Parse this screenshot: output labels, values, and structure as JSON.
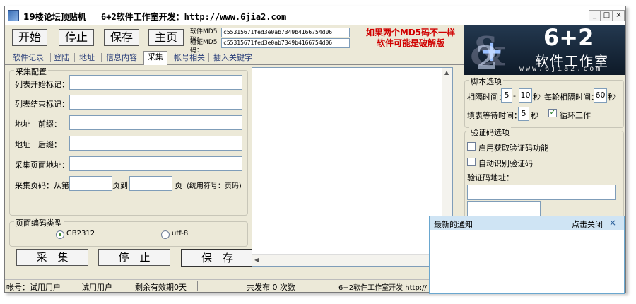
{
  "titlebar": {
    "title": "19楼论坛顶贴机",
    "subtitle": "6+2软件工作室开发：http://www.6jia2.com",
    "controls": {
      "minimize": "_",
      "maximize": "□",
      "close": "×"
    }
  },
  "toolbar": {
    "start": "开始",
    "stop": "停止",
    "save": "保存",
    "home": "主页"
  },
  "md5": {
    "software_label": "软件MD5码：",
    "software_value": "c55315671fed3e0ab7349b4166754d06",
    "verify_label": "验证MD5码：",
    "verify_value": "c55315671fed3e0ab7349b4166754d06"
  },
  "warning": {
    "line1": "如果两个MD5码不一样",
    "line2": "软件可能是破解版"
  },
  "logo": {
    "brand": "6+2",
    "studio": "软件工作室",
    "url": "www.6jia2.com"
  },
  "tabs": [
    "软件记录",
    "登陆",
    "地址",
    "信息内容",
    "采集",
    "帐号相关",
    "插入关键字"
  ],
  "collect": {
    "group_label": "采集配置",
    "list_start": "列表开始标记：",
    "list_end": "列表结束标记：",
    "addr_prefix": "地址　前缀：",
    "addr_suffix": "地址　后缀：",
    "page_url": "采集页面地址：",
    "page_code_from": "采集页码：从第",
    "page_to": "页到",
    "page_unit": "页",
    "page_hint": "(统用符号：页码)"
  },
  "encoding": {
    "group_label": "页面编码类型",
    "opt1": "GB2312",
    "opt2": "utf-8",
    "selected": "GB2312"
  },
  "actions": {
    "collect": "采　集",
    "stop": "停　止",
    "save": "保　存"
  },
  "script_options": {
    "group_label": "脚本选项",
    "interval_label": "相隔时间：",
    "interval_min": "5",
    "dash": "-",
    "interval_max": "10",
    "sec": "秒",
    "round_label": "每轮相隔时间：",
    "round_value": "60",
    "wait_label": "填表等待时间：",
    "wait_value": "5",
    "loop_label": "循环工作",
    "loop_checked": true
  },
  "captcha": {
    "group_label": "验证码选项",
    "enable_label": "启用获取验证码功能",
    "auto_label": "自动识别验证码",
    "addr_label": "验证码地址："
  },
  "statusbar": {
    "account": "帐号：试用用户",
    "user": "试用用户",
    "remaining": "剩余有效期0天",
    "published": "共发布 0 次数",
    "dev": "6+2软件工作室开发 http://"
  },
  "popup": {
    "title": "最新的通知",
    "close_text": "点击关闭",
    "close_x": "×"
  }
}
